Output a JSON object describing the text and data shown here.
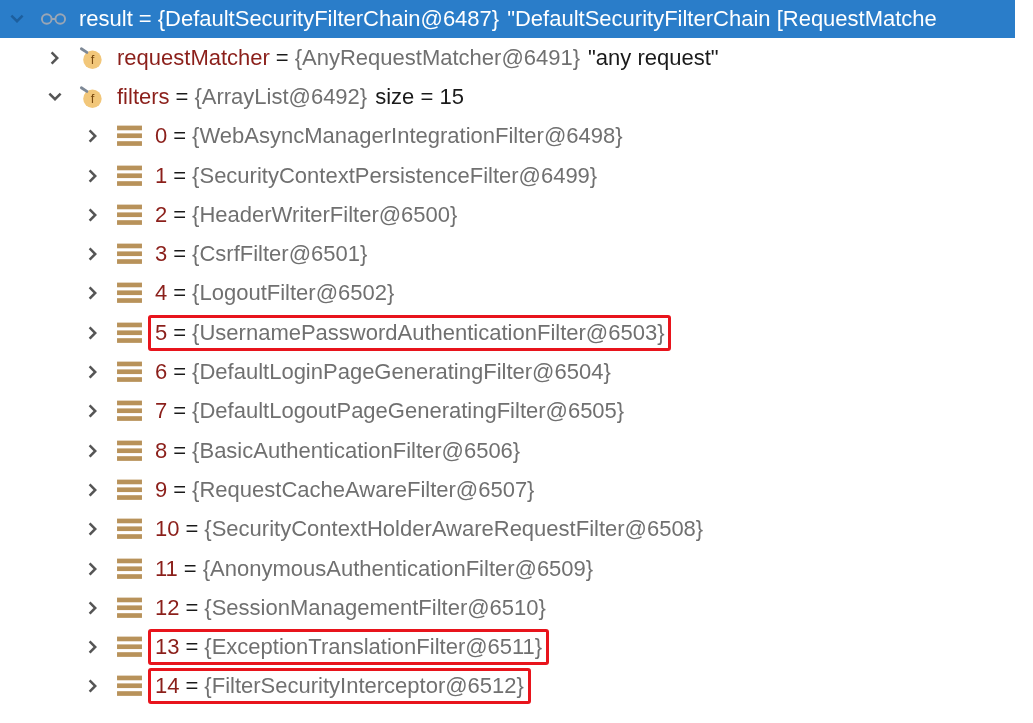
{
  "tree": [
    {
      "kind": "watch",
      "name": "result",
      "sep": "=",
      "value": "{DefaultSecurityFilterChain@6487}",
      "extra": "\"DefaultSecurityFilterChain [RequestMatche",
      "expanded": true,
      "selected": true,
      "boxed": false,
      "children": [
        {
          "kind": "field",
          "badge": "f",
          "name": "requestMatcher",
          "sep": "=",
          "value": "{AnyRequestMatcher@6491}",
          "extra": "\"any request\"",
          "expanded": false,
          "selected": false,
          "boxed": false
        },
        {
          "kind": "field",
          "badge": "f",
          "name": "filters",
          "sep": "=",
          "value": "{ArrayList@6492}",
          "extra": "size = 15",
          "expanded": true,
          "selected": false,
          "boxed": false,
          "children": [
            {
              "kind": "element",
              "name": "0",
              "sep": "=",
              "value": "{WebAsyncManagerIntegrationFilter@6498}",
              "expanded": false,
              "selected": false,
              "boxed": false
            },
            {
              "kind": "element",
              "name": "1",
              "sep": "=",
              "value": "{SecurityContextPersistenceFilter@6499}",
              "expanded": false,
              "selected": false,
              "boxed": false
            },
            {
              "kind": "element",
              "name": "2",
              "sep": "=",
              "value": "{HeaderWriterFilter@6500}",
              "expanded": false,
              "selected": false,
              "boxed": false
            },
            {
              "kind": "element",
              "name": "3",
              "sep": "=",
              "value": "{CsrfFilter@6501}",
              "expanded": false,
              "selected": false,
              "boxed": false
            },
            {
              "kind": "element",
              "name": "4",
              "sep": "=",
              "value": "{LogoutFilter@6502}",
              "expanded": false,
              "selected": false,
              "boxed": false
            },
            {
              "kind": "element",
              "name": "5",
              "sep": "=",
              "value": "{UsernamePasswordAuthenticationFilter@6503}",
              "expanded": false,
              "selected": false,
              "boxed": true
            },
            {
              "kind": "element",
              "name": "6",
              "sep": "=",
              "value": "{DefaultLoginPageGeneratingFilter@6504}",
              "expanded": false,
              "selected": false,
              "boxed": false
            },
            {
              "kind": "element",
              "name": "7",
              "sep": "=",
              "value": "{DefaultLogoutPageGeneratingFilter@6505}",
              "expanded": false,
              "selected": false,
              "boxed": false
            },
            {
              "kind": "element",
              "name": "8",
              "sep": "=",
              "value": "{BasicAuthenticationFilter@6506}",
              "expanded": false,
              "selected": false,
              "boxed": false
            },
            {
              "kind": "element",
              "name": "9",
              "sep": "=",
              "value": "{RequestCacheAwareFilter@6507}",
              "expanded": false,
              "selected": false,
              "boxed": false
            },
            {
              "kind": "element",
              "name": "10",
              "sep": "=",
              "value": "{SecurityContextHolderAwareRequestFilter@6508}",
              "expanded": false,
              "selected": false,
              "boxed": false
            },
            {
              "kind": "element",
              "name": "11",
              "sep": "=",
              "value": "{AnonymousAuthenticationFilter@6509}",
              "expanded": false,
              "selected": false,
              "boxed": false
            },
            {
              "kind": "element",
              "name": "12",
              "sep": "=",
              "value": "{SessionManagementFilter@6510}",
              "expanded": false,
              "selected": false,
              "boxed": false
            },
            {
              "kind": "element",
              "name": "13",
              "sep": "=",
              "value": "{ExceptionTranslationFilter@6511}",
              "expanded": false,
              "selected": false,
              "boxed": true
            },
            {
              "kind": "element",
              "name": "14",
              "sep": "=",
              "value": "{FilterSecurityInterceptor@6512}",
              "expanded": false,
              "selected": false,
              "boxed": true
            }
          ]
        }
      ]
    }
  ]
}
